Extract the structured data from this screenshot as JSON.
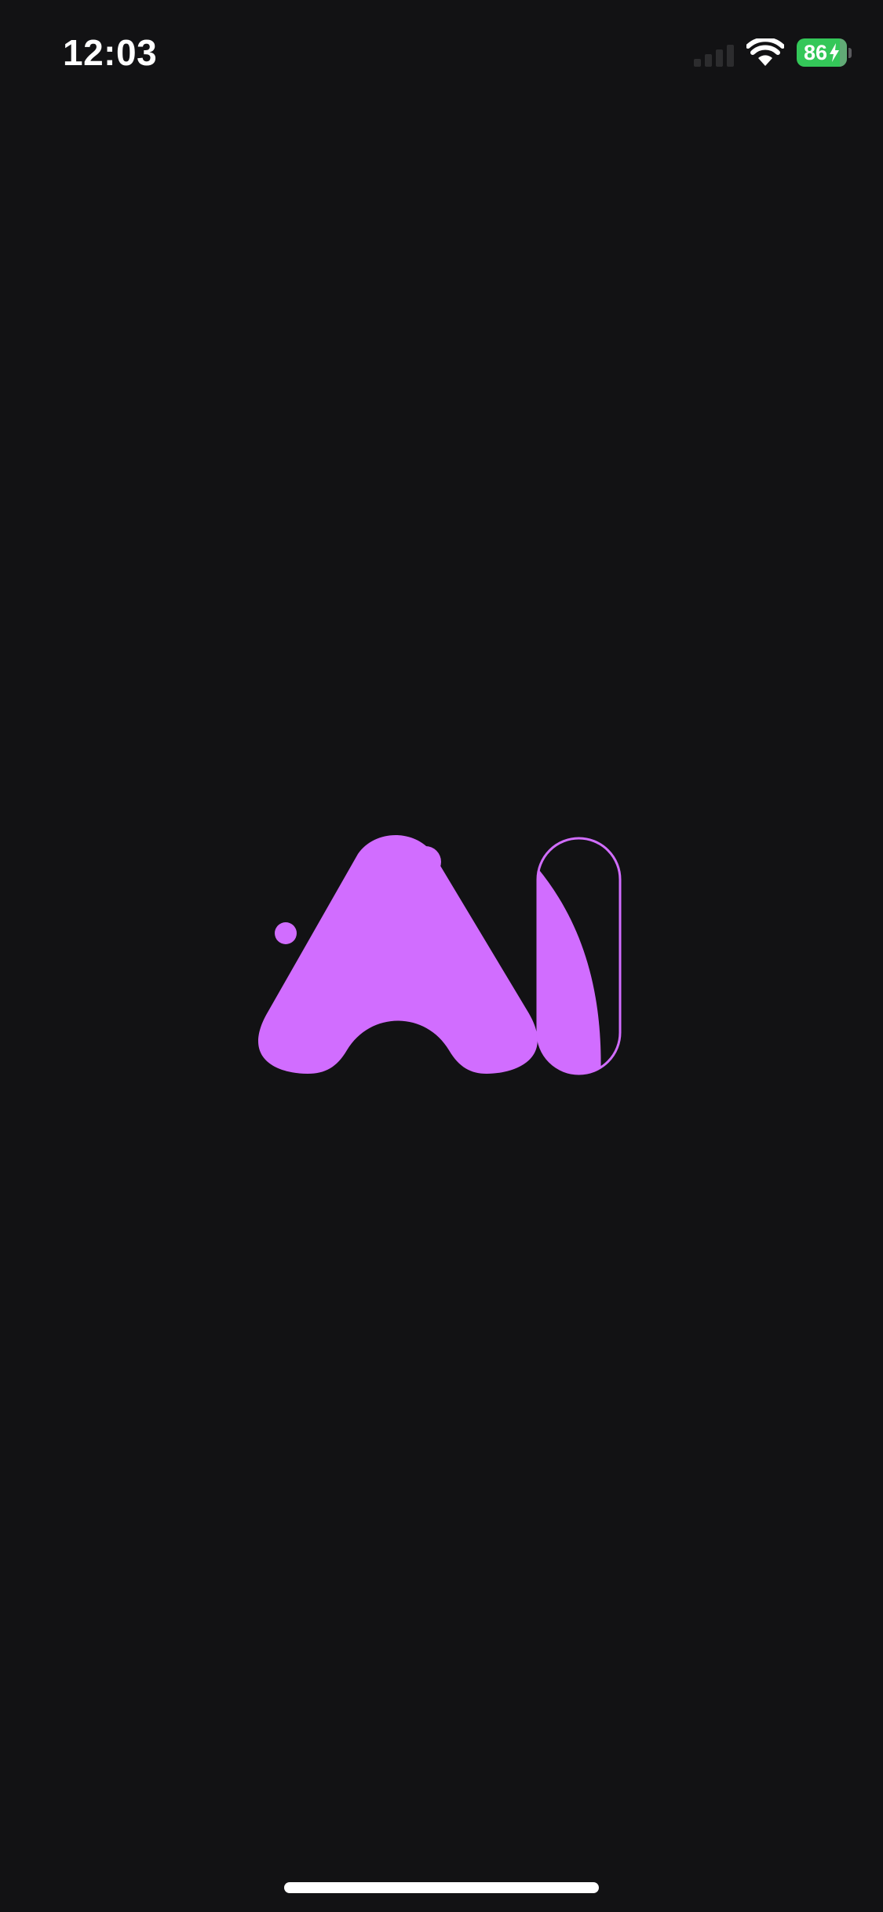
{
  "status_bar": {
    "time": "12:03",
    "battery_level": "86",
    "battery_fraction": 0.86,
    "charging": true,
    "signal_bars_active": 0,
    "icons": [
      "cellular-signal-icon",
      "wifi-icon",
      "battery-icon",
      "charging-bolt-icon"
    ]
  },
  "splash": {
    "logo": "logo-mark",
    "brand_color": "#D16DFF"
  },
  "colors": {
    "background": "#121214",
    "battery_green": "#34C759",
    "home_indicator": "#FFFFFF"
  }
}
